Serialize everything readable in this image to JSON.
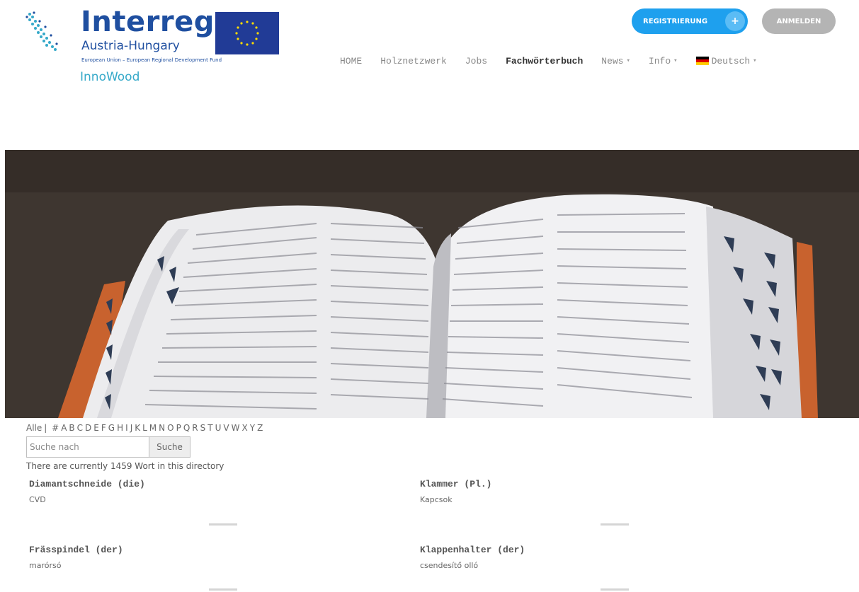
{
  "logo": {
    "title": "Interreg",
    "subtitle": "Austria-Hungary",
    "fund": "European Union – European Regional Development Fund",
    "brand": "InnoWood",
    "colors": {
      "blue": "#1f4fa0",
      "teal": "#35a9c9"
    }
  },
  "header": {
    "register_label": "REGISTRIERUNG",
    "register_icon": "plus-icon",
    "login_label": "ANMELDEN"
  },
  "nav": {
    "items": [
      {
        "label": "HOME",
        "has_caret": false,
        "active": false
      },
      {
        "label": "Holznetzwerk",
        "has_caret": false,
        "active": false
      },
      {
        "label": "Jobs",
        "has_caret": false,
        "active": false
      },
      {
        "label": "Fachwörterbuch",
        "has_caret": false,
        "active": true
      },
      {
        "label": "News",
        "has_caret": true,
        "active": false
      },
      {
        "label": "Info",
        "has_caret": true,
        "active": false
      }
    ],
    "language": "Deutsch",
    "language_icon": "german-flag-icon",
    "caret": "▾"
  },
  "dictionary": {
    "alpha_all": "Alle",
    "alpha_sep": "|",
    "letters": [
      "#",
      "A",
      "B",
      "C",
      "D",
      "E",
      "F",
      "G",
      "H",
      "I",
      "J",
      "K",
      "L",
      "M",
      "N",
      "O",
      "P",
      "Q",
      "R",
      "S",
      "T",
      "U",
      "V",
      "W",
      "X",
      "Y",
      "Z"
    ],
    "search_placeholder": "Suche nach",
    "search_button": "Suche",
    "count_text": "There are currently 1459 Wort in this directory",
    "entries": [
      {
        "term": "Diamantschneide (die)",
        "definition": "CVD"
      },
      {
        "term": "Klammer (Pl.)",
        "definition": "Kapcsok"
      },
      {
        "term": "Frässpindel (der)",
        "definition": "marórsó"
      },
      {
        "term": "Klappenhalter (der)",
        "definition": "csendesítő olló"
      }
    ]
  },
  "colors": {
    "accent": "#1ea0ee",
    "login_bg": "#b4b4b4",
    "hero_bg": "#3e3630"
  }
}
